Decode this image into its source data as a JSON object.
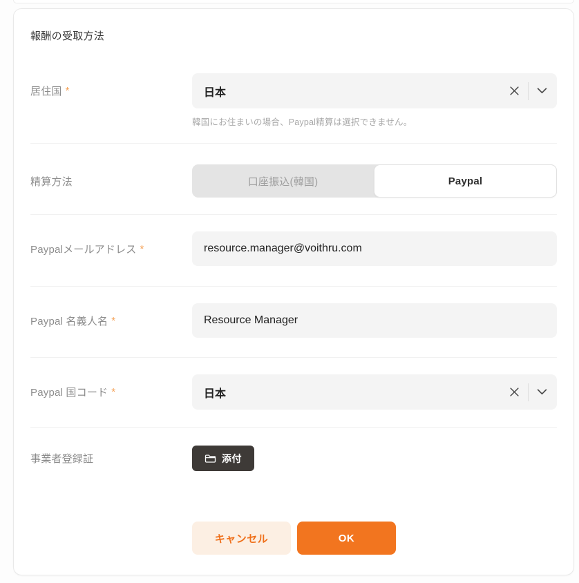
{
  "card": {
    "title": "報酬の受取方法"
  },
  "fields": {
    "residence": {
      "label": "居住国",
      "required": "*",
      "value": "日本",
      "helper": "韓国にお住まいの場合、Paypal精算は選択できません。"
    },
    "settlement": {
      "label": "精算方法",
      "options": [
        {
          "label": "口座振込(韓国)",
          "selected": false
        },
        {
          "label": "Paypal",
          "selected": true
        }
      ]
    },
    "paypal_email": {
      "label": "Paypalメールアドレス",
      "required": "*",
      "value": "resource.manager@voithru.com"
    },
    "paypal_name": {
      "label": "Paypal 名義人名",
      "required": "*",
      "value": "Resource Manager"
    },
    "paypal_country": {
      "label": "Paypal 国コード",
      "required": "*",
      "value": "日本"
    },
    "business_cert": {
      "label": "事業者登録証",
      "attach_label": "添付"
    }
  },
  "actions": {
    "cancel": "キャンセル",
    "ok": "OK"
  },
  "icons": {
    "clear": "x-icon",
    "dropdown": "chevron-down-icon",
    "attach": "folder-icon"
  },
  "colors": {
    "accent": "#F2751F",
    "accent_soft": "#FCEFE3",
    "field_bg": "#F4F4F4",
    "dark_button": "#3E3A37",
    "label": "#8C8C8C",
    "asterisk": "#F5A156"
  }
}
